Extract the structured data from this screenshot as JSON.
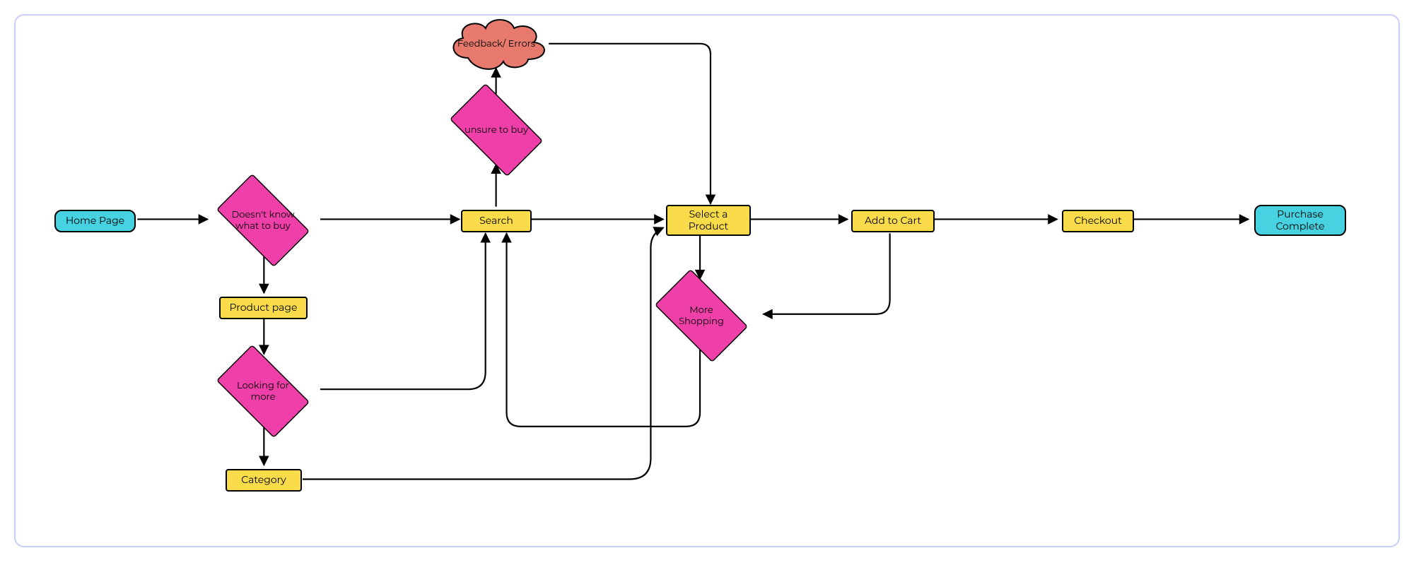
{
  "nodes": {
    "home": {
      "label": "Home Page"
    },
    "unknown": {
      "label": "Doesn't know what to buy"
    },
    "search": {
      "label": "Search"
    },
    "select": {
      "label": "Select a Product"
    },
    "cart": {
      "label": "Add to Cart"
    },
    "checkout": {
      "label": "Checkout"
    },
    "complete": {
      "label": "Purchase Complete"
    },
    "unsure": {
      "label": "unsure to buy"
    },
    "feedback": {
      "label": "Feedback/ Errors"
    },
    "product": {
      "label": "Product page"
    },
    "looking": {
      "label": "Looking for more"
    },
    "category": {
      "label": "Category"
    },
    "moreshop": {
      "label": "More Shopping"
    }
  },
  "colors": {
    "terminal": "#46d2e0",
    "process": "#fadc4a",
    "decision": "#ef3fa9",
    "cloud": "#e77a6c",
    "frame": "#c9cffc"
  },
  "edges": [
    {
      "from": "home",
      "to": "unknown"
    },
    {
      "from": "unknown",
      "to": "search"
    },
    {
      "from": "search",
      "to": "select"
    },
    {
      "from": "select",
      "to": "cart"
    },
    {
      "from": "cart",
      "to": "checkout"
    },
    {
      "from": "checkout",
      "to": "complete"
    },
    {
      "from": "search",
      "to": "unsure"
    },
    {
      "from": "unsure",
      "to": "feedback"
    },
    {
      "from": "feedback",
      "to": "select"
    },
    {
      "from": "unknown",
      "to": "product"
    },
    {
      "from": "product",
      "to": "looking"
    },
    {
      "from": "looking",
      "to": "category"
    },
    {
      "from": "looking",
      "to": "search"
    },
    {
      "from": "category",
      "to": "select"
    },
    {
      "from": "select",
      "to": "moreshop"
    },
    {
      "from": "cart",
      "to": "moreshop"
    },
    {
      "from": "moreshop",
      "to": "search"
    }
  ]
}
